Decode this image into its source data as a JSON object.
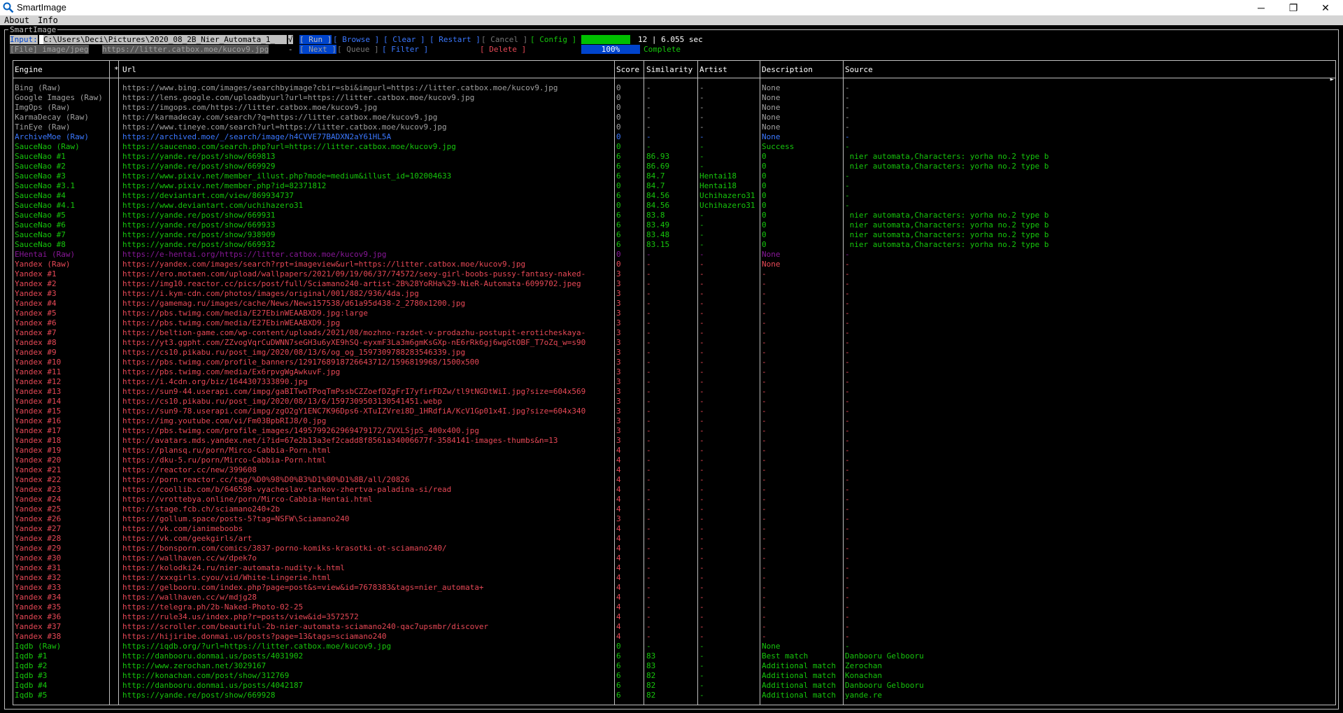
{
  "window": {
    "title": "SmartImage",
    "minimize": "─",
    "restore": "❐",
    "close": "✕"
  },
  "menu": {
    "about": "About",
    "info": "Info"
  },
  "frame_title": "SmartImage",
  "toolbar": {
    "input_label": "Input:",
    "input_value": "C:\\Users\\Deci\\Pictures\\2020_08_2B_Nier_Automata_1_",
    "check_label": "√",
    "run": "[ Run ]",
    "browse": "[ Browse ]",
    "clear": "[ Clear ]",
    "restart": "[ Restart ]",
    "cancel": "[ Cancel ]",
    "config": "[ Config ]",
    "stats": "12 | 6.055 sec",
    "file_label": "[File] image/jpeg",
    "file_url": "https://litter.catbox.moe/kucov9.jpg",
    "dash": "-",
    "next": "[ Next ]",
    "queue": "[ Queue ]",
    "filter": "[ Filter ]",
    "delete": "[ Delete ]",
    "progress_pct": "100%",
    "progress_fraction": 1.0,
    "status": "Complete"
  },
  "colors": {
    "raw": "#a0a0a0",
    "archive": "#3b78ff",
    "saucenao": "#16c60c",
    "ehentai": "#881798",
    "yandex": "#e74856",
    "iqdb": "#16c60c",
    "run_bg": "#0044cc",
    "restart_fg": "#3b78ff",
    "config_fg": "#16c60c",
    "delete_fg": "#e74856"
  },
  "table": {
    "headers": [
      "Engine",
      "*",
      "Url",
      "Score",
      "Similarity",
      "Artist",
      "Description",
      "Source"
    ],
    "rows": [
      {
        "engine": "Bing (Raw)",
        "url": "https://www.bing.com/images/searchbyimage?cbir=sbi&imgurl=https://litter.catbox.moe/kucov9.jpg",
        "score": "0",
        "similarity": "-",
        "artist": "-",
        "description": "None",
        "source": "-",
        "color": "raw"
      },
      {
        "engine": "Google Images (Raw)",
        "url": "https://lens.google.com/uploadbyurl?url=https://litter.catbox.moe/kucov9.jpg",
        "score": "0",
        "similarity": "-",
        "artist": "-",
        "description": "None",
        "source": "-",
        "color": "raw"
      },
      {
        "engine": "ImgOps (Raw)",
        "url": "https://imgops.com/https://litter.catbox.moe/kucov9.jpg",
        "score": "0",
        "similarity": "-",
        "artist": "-",
        "description": "None",
        "source": "-",
        "color": "raw"
      },
      {
        "engine": "KarmaDecay (Raw)",
        "url": "http://karmadecay.com/search/?q=https://litter.catbox.moe/kucov9.jpg",
        "score": "0",
        "similarity": "-",
        "artist": "-",
        "description": "None",
        "source": "-",
        "color": "raw"
      },
      {
        "engine": "TinEye (Raw)",
        "url": "https://www.tineye.com/search?url=https://litter.catbox.moe/kucov9.jpg",
        "score": "0",
        "similarity": "-",
        "artist": "-",
        "description": "None",
        "source": "-",
        "color": "raw"
      },
      {
        "engine": "ArchiveMoe (Raw)",
        "url": "https://archived.moe/_/search/image/h4CVVE77BADXN2aY61HL5A",
        "score": "0",
        "similarity": "-",
        "artist": "-",
        "description": "None",
        "source": "-",
        "color": "archive"
      },
      {
        "engine": "SauceNao (Raw)",
        "url": "https://saucenao.com/search.php?url=https://litter.catbox.moe/kucov9.jpg",
        "score": "0",
        "similarity": "-",
        "artist": "-",
        "description": "Success",
        "source": "-",
        "color": "saucenao"
      },
      {
        "engine": "SauceNao #1",
        "url": "https://yande.re/post/show/669813",
        "score": "6",
        "similarity": "86.93",
        "artist": "-",
        "description": "0",
        "source": " nier automata,Characters: yorha no.2 type b",
        "color": "saucenao"
      },
      {
        "engine": "SauceNao #2",
        "url": "https://yande.re/post/show/669929",
        "score": "6",
        "similarity": "86.69",
        "artist": "-",
        "description": "0",
        "source": " nier automata,Characters: yorha no.2 type b",
        "color": "saucenao"
      },
      {
        "engine": "SauceNao #3",
        "url": "https://www.pixiv.net/member_illust.php?mode=medium&illust_id=102004633",
        "score": "6",
        "similarity": "84.7",
        "artist": "Hentai18",
        "description": "0",
        "source": "-",
        "color": "saucenao"
      },
      {
        "engine": "SauceNao #3.1",
        "url": "https://www.pixiv.net/member.php?id=82371812",
        "score": "0",
        "similarity": "84.7",
        "artist": "Hentai18",
        "description": "0",
        "source": "-",
        "color": "saucenao"
      },
      {
        "engine": "SauceNao #4",
        "url": "https://deviantart.com/view/869934737",
        "score": "6",
        "similarity": "84.56",
        "artist": "Uchihazero31",
        "description": "0",
        "source": "-",
        "color": "saucenao"
      },
      {
        "engine": "SauceNao #4.1",
        "url": "https://www.deviantart.com/uchihazero31",
        "score": "0",
        "similarity": "84.56",
        "artist": "Uchihazero31",
        "description": "0",
        "source": "-",
        "color": "saucenao"
      },
      {
        "engine": "SauceNao #5",
        "url": "https://yande.re/post/show/669931",
        "score": "6",
        "similarity": "83.8",
        "artist": "-",
        "description": "0",
        "source": " nier automata,Characters: yorha no.2 type b",
        "color": "saucenao"
      },
      {
        "engine": "SauceNao #6",
        "url": "https://yande.re/post/show/669933",
        "score": "6",
        "similarity": "83.49",
        "artist": "-",
        "description": "0",
        "source": " nier automata,Characters: yorha no.2 type b",
        "color": "saucenao"
      },
      {
        "engine": "SauceNao #7",
        "url": "https://yande.re/post/show/938909",
        "score": "6",
        "similarity": "83.48",
        "artist": "-",
        "description": "0",
        "source": " nier automata,Characters: yorha no.2 type b",
        "color": "saucenao"
      },
      {
        "engine": "SauceNao #8",
        "url": "https://yande.re/post/show/669932",
        "score": "6",
        "similarity": "83.15",
        "artist": "-",
        "description": "0",
        "source": " nier automata,Characters: yorha no.2 type b",
        "color": "saucenao"
      },
      {
        "engine": "EHentai (Raw)",
        "url": "https://e-hentai.org/https://litter.catbox.moe/kucov9.jpg",
        "score": "0",
        "similarity": "-",
        "artist": "-",
        "description": "None",
        "source": "-",
        "color": "ehentai"
      },
      {
        "engine": "Yandex (Raw)",
        "url": "https://yandex.com/images/search?rpt=imageview&url=https://litter.catbox.moe/kucov9.jpg",
        "score": "0",
        "similarity": "-",
        "artist": "-",
        "description": "None",
        "source": "-",
        "color": "yandex"
      },
      {
        "engine": "Yandex #1",
        "url": "https://ero.motaen.com/upload/wallpapers/2021/09/19/06/37/74572/sexy-girl-boobs-pussy-fantasy-naked-",
        "score": "3",
        "similarity": "-",
        "artist": "-",
        "description": "-",
        "source": "-",
        "color": "yandex"
      },
      {
        "engine": "Yandex #2",
        "url": "https://img10.reactor.cc/pics/post/full/Sciamano240-artist-2B%28YoRHa%29-NieR-Automata-6099702.jpeg",
        "score": "3",
        "similarity": "-",
        "artist": "-",
        "description": "-",
        "source": "-",
        "color": "yandex"
      },
      {
        "engine": "Yandex #3",
        "url": "https://i.kym-cdn.com/photos/images/original/001/882/936/4da.jpg",
        "score": "3",
        "similarity": "-",
        "artist": "-",
        "description": "-",
        "source": "-",
        "color": "yandex"
      },
      {
        "engine": "Yandex #4",
        "url": "https://gamemag.ru/images/cache/News/News157538/d61a95d438-2_2780x1200.jpg",
        "score": "3",
        "similarity": "-",
        "artist": "-",
        "description": "-",
        "source": "-",
        "color": "yandex"
      },
      {
        "engine": "Yandex #5",
        "url": "https://pbs.twimg.com/media/E27EbinWEAABXD9.jpg:large",
        "score": "3",
        "similarity": "-",
        "artist": "-",
        "description": "-",
        "source": "-",
        "color": "yandex"
      },
      {
        "engine": "Yandex #6",
        "url": "https://pbs.twimg.com/media/E27EbinWEAABXD9.jpg",
        "score": "3",
        "similarity": "-",
        "artist": "-",
        "description": "-",
        "source": "-",
        "color": "yandex"
      },
      {
        "engine": "Yandex #7",
        "url": "https://beltion-game.com/wp-content/uploads/2021/08/mozhno-razdet-v-prodazhu-postupit-eroticheskaya-",
        "score": "3",
        "similarity": "-",
        "artist": "-",
        "description": "-",
        "source": "-",
        "color": "yandex"
      },
      {
        "engine": "Yandex #8",
        "url": "https://yt3.ggpht.com/ZZvogVqrCuDWNN7seGH3u6yXE9hSQ-eyxmF3La3m6gmKsGXp-nE6rRk6gj6wgGtOBF_T7oZq_w=s90",
        "score": "3",
        "similarity": "-",
        "artist": "-",
        "description": "-",
        "source": "-",
        "color": "yandex"
      },
      {
        "engine": "Yandex #9",
        "url": "https://cs10.pikabu.ru/post_img/2020/08/13/6/og_og_1597309788283546339.jpg",
        "score": "3",
        "similarity": "-",
        "artist": "-",
        "description": "-",
        "source": "-",
        "color": "yandex"
      },
      {
        "engine": "Yandex #10",
        "url": "https://pbs.twimg.com/profile_banners/1291768918726643712/1596819968/1500x500",
        "score": "3",
        "similarity": "-",
        "artist": "-",
        "description": "-",
        "source": "-",
        "color": "yandex"
      },
      {
        "engine": "Yandex #11",
        "url": "https://pbs.twimg.com/media/Ex6rpvgWgAwkuvF.jpg",
        "score": "3",
        "similarity": "-",
        "artist": "-",
        "description": "-",
        "source": "-",
        "color": "yandex"
      },
      {
        "engine": "Yandex #12",
        "url": "https://i.4cdn.org/biz/1644307333890.jpg",
        "score": "3",
        "similarity": "-",
        "artist": "-",
        "description": "-",
        "source": "-",
        "color": "yandex"
      },
      {
        "engine": "Yandex #13",
        "url": "https://sun9-44.userapi.com/impg/gaBITwoTPoqTmPssbCZZoefDZgFrI7yfirFDZw/tl9tNGDtWiI.jpg?size=604x569",
        "score": "3",
        "similarity": "-",
        "artist": "-",
        "description": "-",
        "source": "-",
        "color": "yandex"
      },
      {
        "engine": "Yandex #14",
        "url": "https://cs10.pikabu.ru/post_img/2020/08/13/6/1597309503130541451.webp",
        "score": "3",
        "similarity": "-",
        "artist": "-",
        "description": "-",
        "source": "-",
        "color": "yandex"
      },
      {
        "engine": "Yandex #15",
        "url": "https://sun9-78.userapi.com/impg/zgO2gY1ENC7K96Dps6-XTuIZVrei8D_1HRdfiA/KcV1Gp01x4I.jpg?size=604x340",
        "score": "3",
        "similarity": "-",
        "artist": "-",
        "description": "-",
        "source": "-",
        "color": "yandex"
      },
      {
        "engine": "Yandex #16",
        "url": "https://img.youtube.com/vi/Fm03BpbRIJ8/0.jpg",
        "score": "3",
        "similarity": "-",
        "artist": "-",
        "description": "-",
        "source": "-",
        "color": "yandex"
      },
      {
        "engine": "Yandex #17",
        "url": "https://pbs.twimg.com/profile_images/1495799262969479172/ZVXLSjpS_400x400.jpg",
        "score": "3",
        "similarity": "-",
        "artist": "-",
        "description": "-",
        "source": "-",
        "color": "yandex"
      },
      {
        "engine": "Yandex #18",
        "url": "http://avatars.mds.yandex.net/i?id=67e2b13a3ef2cadd8f8561a34006677f-3584141-images-thumbs&n=13",
        "score": "3",
        "similarity": "-",
        "artist": "-",
        "description": "-",
        "source": "-",
        "color": "yandex"
      },
      {
        "engine": "Yandex #19",
        "url": "https://plansq.ru/porn/Mirco-Cabbia-Porn.html",
        "score": "4",
        "similarity": "-",
        "artist": "-",
        "description": "-",
        "source": "-",
        "color": "yandex"
      },
      {
        "engine": "Yandex #20",
        "url": "https://dku-5.ru/porn/Mirco-Cabbia-Porn.html",
        "score": "4",
        "similarity": "-",
        "artist": "-",
        "description": "-",
        "source": "-",
        "color": "yandex"
      },
      {
        "engine": "Yandex #21",
        "url": "https://reactor.cc/new/399608",
        "score": "4",
        "similarity": "-",
        "artist": "-",
        "description": "-",
        "source": "-",
        "color": "yandex"
      },
      {
        "engine": "Yandex #22",
        "url": "https://porn.reactor.cc/tag/%D0%98%D0%B3%D1%80%D1%8B/all/20826",
        "score": "4",
        "similarity": "-",
        "artist": "-",
        "description": "-",
        "source": "-",
        "color": "yandex"
      },
      {
        "engine": "Yandex #23",
        "url": "https://coollib.com/b/646598-vyacheslav-tankov-zhertva-paladina-si/read",
        "score": "4",
        "similarity": "-",
        "artist": "-",
        "description": "-",
        "source": "-",
        "color": "yandex"
      },
      {
        "engine": "Yandex #24",
        "url": "https://vrottebya.online/porn/Mirco-Cabbia-Hentai.html",
        "score": "4",
        "similarity": "-",
        "artist": "-",
        "description": "-",
        "source": "-",
        "color": "yandex"
      },
      {
        "engine": "Yandex #25",
        "url": "http://stage.fcb.ch/sciamano240+2b",
        "score": "4",
        "similarity": "-",
        "artist": "-",
        "description": "-",
        "source": "-",
        "color": "yandex"
      },
      {
        "engine": "Yandex #26",
        "url": "https://gollum.space/posts-5?tag=NSFW\\Sciamano240",
        "score": "3",
        "similarity": "-",
        "artist": "-",
        "description": "-",
        "source": "-",
        "color": "yandex"
      },
      {
        "engine": "Yandex #27",
        "url": "https://vk.com/ianimeboobs",
        "score": "4",
        "similarity": "-",
        "artist": "-",
        "description": "-",
        "source": "-",
        "color": "yandex"
      },
      {
        "engine": "Yandex #28",
        "url": "https://vk.com/geekgirls/art",
        "score": "4",
        "similarity": "-",
        "artist": "-",
        "description": "-",
        "source": "-",
        "color": "yandex"
      },
      {
        "engine": "Yandex #29",
        "url": "https://bonsporn.com/comics/3837-porno-komiks-krasotki-ot-sciamano240/",
        "score": "4",
        "similarity": "-",
        "artist": "-",
        "description": "-",
        "source": "-",
        "color": "yandex"
      },
      {
        "engine": "Yandex #30",
        "url": "https://wallhaven.cc/w/dpek7o",
        "score": "4",
        "similarity": "-",
        "artist": "-",
        "description": "-",
        "source": "-",
        "color": "yandex"
      },
      {
        "engine": "Yandex #31",
        "url": "https://kolodki24.ru/nier-automata-nudity-k.html",
        "score": "4",
        "similarity": "-",
        "artist": "-",
        "description": "-",
        "source": "-",
        "color": "yandex"
      },
      {
        "engine": "Yandex #32",
        "url": "https://xxxgirls.cyou/vid/White-Lingerie.html",
        "score": "4",
        "similarity": "-",
        "artist": "-",
        "description": "-",
        "source": "-",
        "color": "yandex"
      },
      {
        "engine": "Yandex #33",
        "url": "https://gelbooru.com/index.php?page=post&s=view&id=7678383&tags=nier_automata+",
        "score": "4",
        "similarity": "-",
        "artist": "-",
        "description": "-",
        "source": "-",
        "color": "yandex"
      },
      {
        "engine": "Yandex #34",
        "url": "https://wallhaven.cc/w/mdjg28",
        "score": "4",
        "similarity": "-",
        "artist": "-",
        "description": "-",
        "source": "-",
        "color": "yandex"
      },
      {
        "engine": "Yandex #35",
        "url": "https://telegra.ph/2b-Naked-Photo-02-25",
        "score": "4",
        "similarity": "-",
        "artist": "-",
        "description": "-",
        "source": "-",
        "color": "yandex"
      },
      {
        "engine": "Yandex #36",
        "url": "https://rule34.us/index.php?r=posts/view&id=3572572",
        "score": "4",
        "similarity": "-",
        "artist": "-",
        "description": "-",
        "source": "-",
        "color": "yandex"
      },
      {
        "engine": "Yandex #37",
        "url": "https://scroller.com/beautiful-2b-nier-automata-sciamano240-qac7upsmbr/discover",
        "score": "4",
        "similarity": "-",
        "artist": "-",
        "description": "-",
        "source": "-",
        "color": "yandex"
      },
      {
        "engine": "Yandex #38",
        "url": "https://hijiribe.donmai.us/posts?page=13&tags=sciamano240",
        "score": "4",
        "similarity": "-",
        "artist": "-",
        "description": "-",
        "source": "-",
        "color": "yandex"
      },
      {
        "engine": "Iqdb (Raw)",
        "url": "https://iqdb.org/?url=https://litter.catbox.moe/kucov9.jpg",
        "score": "0",
        "similarity": "-",
        "artist": "-",
        "description": "None",
        "source": "-",
        "color": "iqdb"
      },
      {
        "engine": "Iqdb #1",
        "url": "http://danbooru.donmai.us/posts/4031902",
        "score": "6",
        "similarity": "83",
        "artist": "-",
        "description": "Best match",
        "source": "Danbooru Gelbooru",
        "color": "iqdb"
      },
      {
        "engine": "Iqdb #2",
        "url": "http://www.zerochan.net/3029167",
        "score": "6",
        "similarity": "83",
        "artist": "-",
        "description": "Additional match",
        "source": "Zerochan",
        "color": "iqdb"
      },
      {
        "engine": "Iqdb #3",
        "url": "http://konachan.com/post/show/312769",
        "score": "6",
        "similarity": "82",
        "artist": "-",
        "description": "Additional match",
        "source": "Konachan",
        "color": "iqdb"
      },
      {
        "engine": "Iqdb #4",
        "url": "http://danbooru.donmai.us/posts/4042187",
        "score": "6",
        "similarity": "82",
        "artist": "-",
        "description": "Additional match",
        "source": "Danbooru Gelbooru",
        "color": "iqdb"
      },
      {
        "engine": "Iqdb #5",
        "url": "https://yande.re/post/show/669928",
        "score": "6",
        "similarity": "82",
        "artist": "-",
        "description": "Additional match",
        "source": "yande.re",
        "color": "iqdb"
      }
    ]
  }
}
